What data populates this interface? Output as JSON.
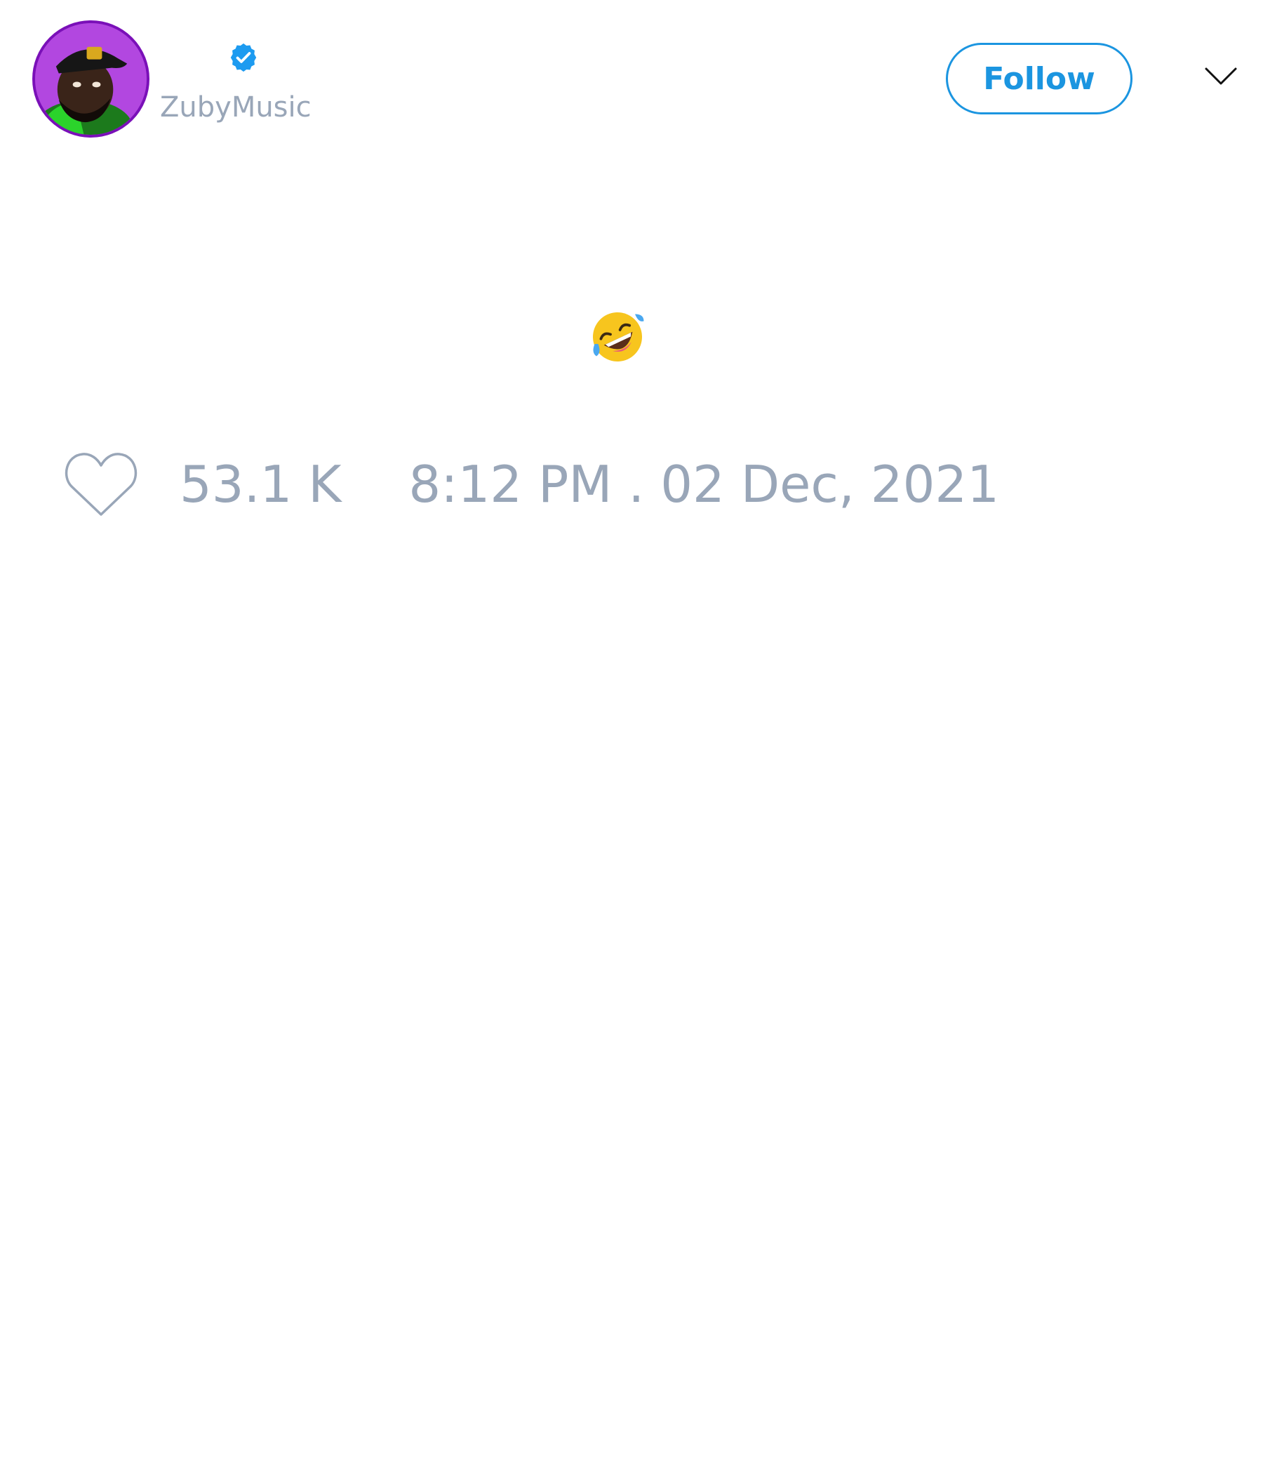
{
  "author": {
    "handle": "ZubyMusic",
    "verified": true,
    "avatar_icon": "profile-avatar"
  },
  "actions": {
    "follow_label": "Follow",
    "more_icon": "chevron-down-icon"
  },
  "tweet": {
    "emoji_icon": "rolling-on-the-floor-laughing-emoji"
  },
  "stats": {
    "likes": "53.1 K",
    "timestamp": "8:12 PM . 02 Dec, 2021",
    "like_icon": "heart-icon"
  },
  "colors": {
    "accent": "#1b95e0",
    "muted_text": "#99a6b8",
    "background": "#ffffff",
    "verified_badge": "#1d9bf0"
  }
}
